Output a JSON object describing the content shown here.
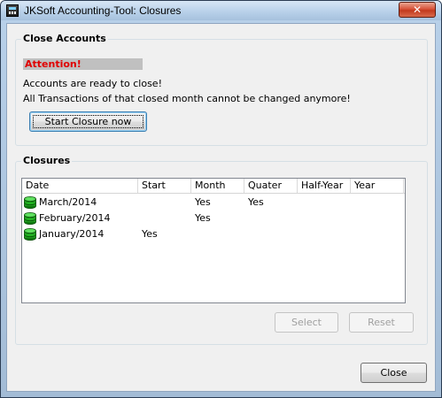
{
  "window": {
    "title": "JKSoft Accounting-Tool: Closures",
    "close_glyph": "✕"
  },
  "close_accounts": {
    "label": "Close Accounts",
    "attention": "Attention!",
    "message_1": "Accounts are ready to close!",
    "message_2": "All Transactions of that closed month cannot be changed anymore!",
    "start_button": "Start Closure now"
  },
  "closures": {
    "label": "Closures",
    "columns": [
      "Date",
      "Start",
      "Month",
      "Quater",
      "Half-Year",
      "Year"
    ],
    "rows": [
      {
        "date": "March/2014",
        "start": "",
        "month": "Yes",
        "quater": "Yes",
        "half_year": "",
        "year": ""
      },
      {
        "date": "February/2014",
        "start": "",
        "month": "Yes",
        "quater": "",
        "half_year": "",
        "year": ""
      },
      {
        "date": "January/2014",
        "start": "Yes",
        "month": "",
        "quater": "",
        "half_year": "",
        "year": ""
      }
    ],
    "row_icon": "database-icon",
    "select_button": "Select",
    "reset_button": "Reset"
  },
  "footer": {
    "close_button": "Close"
  },
  "colors": {
    "attention_text": "#e00000",
    "attention_bg": "#c0c0c0",
    "db_icon": "#22aa22"
  }
}
